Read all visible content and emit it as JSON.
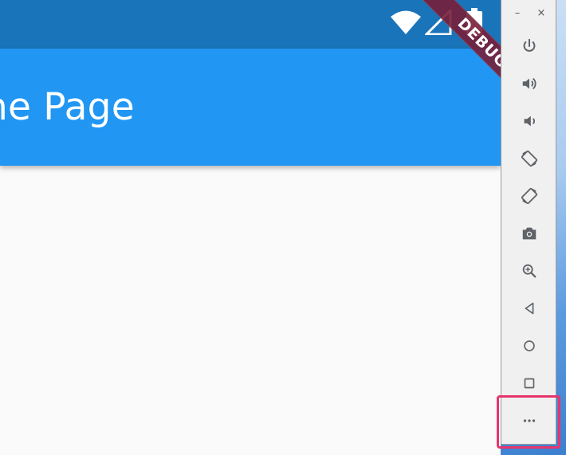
{
  "app": {
    "title": "ne Page",
    "debug_label": "DEBUG"
  },
  "status_bar": {
    "icons": [
      "wifi-icon",
      "cellular-signal-icon",
      "battery-icon"
    ]
  },
  "toolbar": {
    "window_controls": {
      "minimize": "–",
      "close": "×"
    },
    "buttons": [
      "power-icon",
      "volume-up-icon",
      "volume-down-icon",
      "rotate-left-icon",
      "rotate-right-icon",
      "camera-icon",
      "zoom-icon",
      "back-icon",
      "home-icon",
      "overview-icon",
      "more-icon"
    ]
  },
  "colors": {
    "status_bar": "#1a74b9",
    "app_bar": "#2196f3",
    "body_bg": "#fafafa",
    "ribbon": "#771e38",
    "highlight": "#e8356d",
    "toolbar_icon": "#5f6368"
  }
}
